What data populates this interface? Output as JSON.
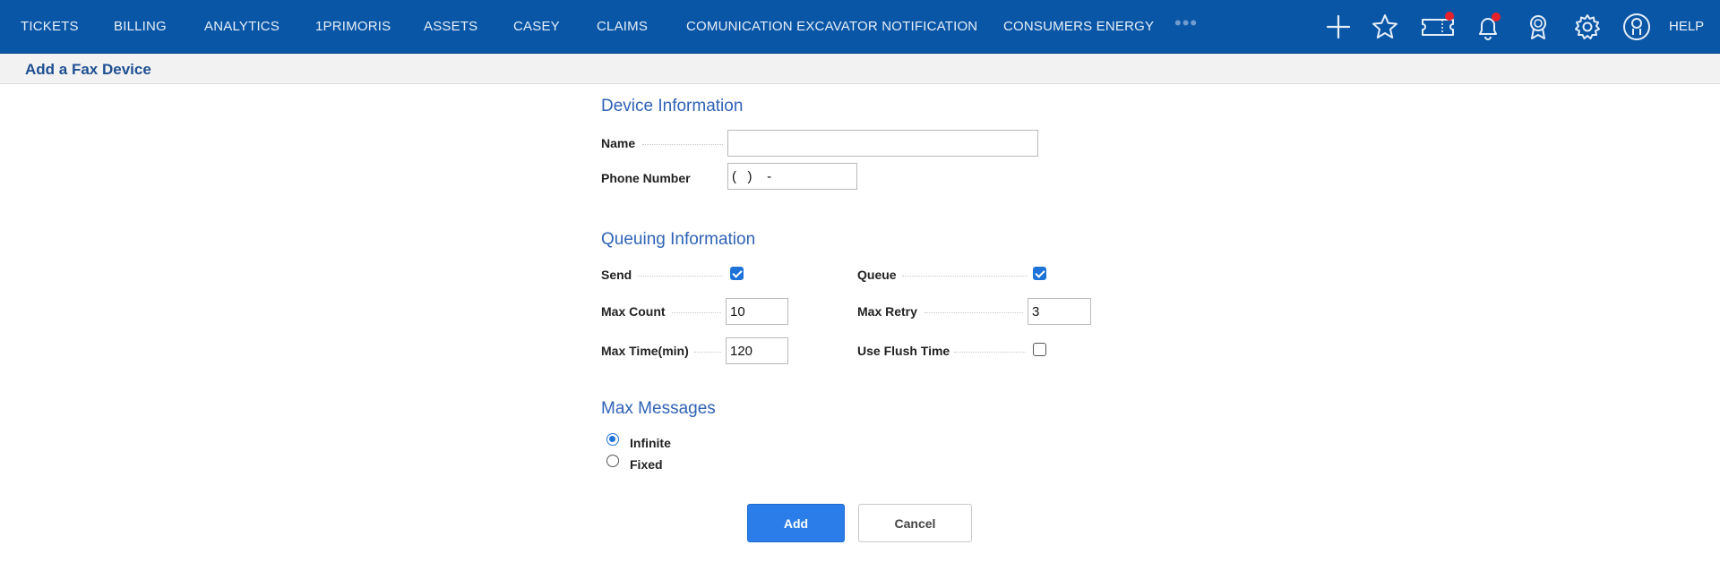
{
  "nav": {
    "items": [
      "TICKETS",
      "BILLING",
      "ANALYTICS",
      "1PRIMORIS",
      "ASSETS",
      "CASEY",
      "CLAIMS",
      "COMUNICATION EXCAVATOR NOTIFICATION",
      "CONSUMERS ENERGY"
    ],
    "more": "•••",
    "help": "HELP",
    "icons": [
      "plus-icon",
      "star-icon",
      "ticket-icon",
      "bell-icon",
      "award-icon",
      "gear-icon",
      "user-icon"
    ],
    "badge_color": "#e8202a",
    "bg_color": "#0a56a6"
  },
  "page": {
    "title": "Add a Fax Device"
  },
  "device": {
    "section_title": "Device Information",
    "name_label": "Name",
    "name_value": "",
    "phone_label": "Phone Number",
    "phone_value": "(   )    -"
  },
  "queuing": {
    "section_title": "Queuing Information",
    "send_label": "Send",
    "send_checked": true,
    "queue_label": "Queue",
    "queue_checked": true,
    "max_count_label": "Max Count",
    "max_count_value": "10",
    "max_retry_label": "Max Retry",
    "max_retry_value": "3",
    "max_time_label": "Max Time(min)",
    "max_time_value": "120",
    "flush_label": "Use Flush Time",
    "flush_checked": false
  },
  "max_messages": {
    "section_title": "Max Messages",
    "options": [
      "Infinite",
      "Fixed"
    ],
    "selected": "Infinite"
  },
  "actions": {
    "add_label": "Add",
    "cancel_label": "Cancel",
    "accent_color": "#2b7de9"
  }
}
